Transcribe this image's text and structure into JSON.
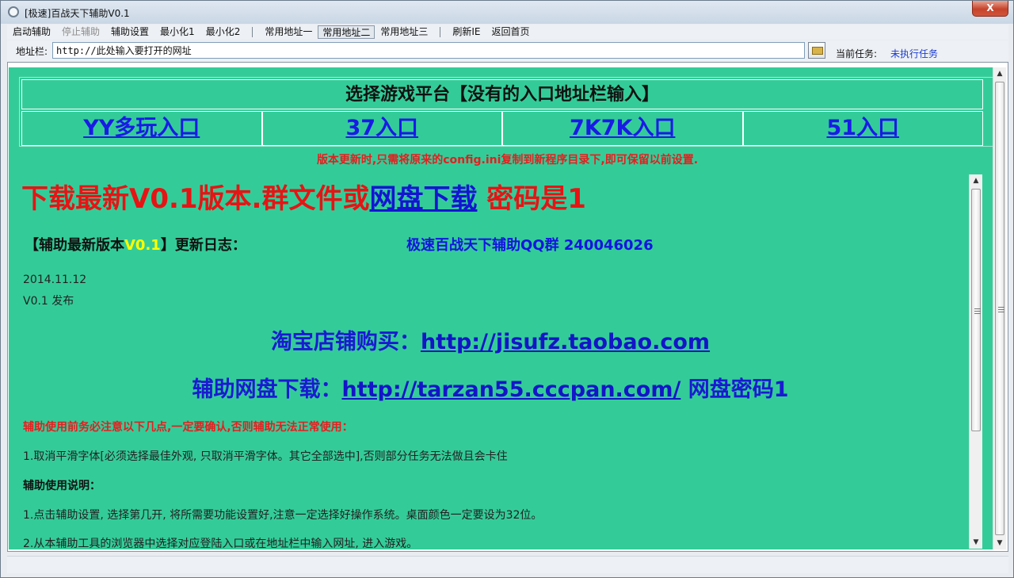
{
  "window": {
    "title": "[极速]百战天下辅助V0.1",
    "close_glyph": "X"
  },
  "menu": {
    "items": [
      {
        "label": "启动辅助",
        "enabled": true
      },
      {
        "label": "停止辅助",
        "enabled": false
      },
      {
        "label": "辅助设置",
        "enabled": true
      },
      {
        "label": "最小化1",
        "enabled": true
      },
      {
        "label": "最小化2",
        "enabled": true
      },
      {
        "label": "常用地址一",
        "enabled": true
      },
      {
        "label": "常用地址二",
        "enabled": true,
        "pressed": true
      },
      {
        "label": "常用地址三",
        "enabled": true
      },
      {
        "label": "刷新IE",
        "enabled": true
      },
      {
        "label": "返回首页",
        "enabled": true
      }
    ]
  },
  "address_bar": {
    "label": "地址栏:",
    "value": "http://此处输入要打开的网址",
    "task_label": "当前任务:",
    "task_value": "未执行任务"
  },
  "platform": {
    "title": "选择游戏平台【没有的入口地址栏输入】",
    "entries": [
      "YY多玩入口",
      "37入口",
      "7K7K入口",
      "51入口"
    ],
    "update_note": "版本更新时,只需将原来的config.ini复制到新程序目录下,即可保留以前设置."
  },
  "page": {
    "download_prefix": "下载最新V0.1版本.群文件或",
    "download_link": "网盘下载",
    "download_suffix": " 密码是1",
    "changelog_prefix": "【辅助最新版本",
    "changelog_version": "V0.1",
    "changelog_suffix": "】更新日志：",
    "qq_group": "极速百战天下辅助QQ群 240046026",
    "log_date": "2014.11.12",
    "log_entry": "V0.1 发布",
    "taobao_label": "淘宝店铺购买：",
    "taobao_url": "http://jisufz.taobao.com",
    "pan_label": "辅助网盘下载：",
    "pan_url": "http://tarzan55.cccpan.com/",
    "pan_suffix": " 网盘密码1",
    "warning": "辅助使用前务必注意以下几点,一定要确认,否则辅助无法正常使用：",
    "step1": "1.取消平滑字体[必须选择最佳外观, 只取消平滑字体。其它全部选中],否则部分任务无法做且会卡住",
    "usage_title": "辅助使用说明：",
    "usage1": "1.点击辅助设置, 选择第几开, 将所需要功能设置好,注意一定选择好操作系统。桌面颜色一定要设为32位。",
    "usage2": "2.从本辅助工具的浏览器中选择对应登陆入口或在地址栏中输入网址, 进入游戏。"
  },
  "colors": {
    "content_bg": "#33cc99",
    "link_blue": "#1414d2",
    "alert_red": "#e61414",
    "version_yellow": "#ffff00"
  }
}
